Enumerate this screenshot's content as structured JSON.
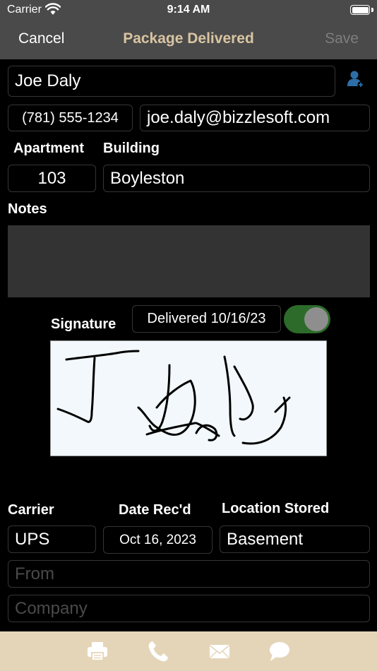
{
  "status": {
    "carrier": "Carrier",
    "time": "9:14 AM"
  },
  "nav": {
    "cancel": "Cancel",
    "title": "Package Delivered",
    "save": "Save"
  },
  "recipient": {
    "name": "Joe Daly",
    "phone": "(781) 555-1234",
    "email": "joe.daly@bizzlesoft.com"
  },
  "labels": {
    "apartment": "Apartment",
    "building": "Building",
    "notes": "Notes",
    "signature": "Signature",
    "carrier": "Carrier",
    "date_recd": "Date Rec'd",
    "location_stored": "Location Stored"
  },
  "unit": {
    "apartment": "103",
    "building": "Boyleston"
  },
  "notes": {
    "value": ""
  },
  "delivery": {
    "status_label": "Delivered 10/16/23",
    "delivered": true
  },
  "package": {
    "carrier": "UPS",
    "date_recd": "Oct 16, 2023",
    "location_stored": "Basement",
    "from_placeholder": "From",
    "company_placeholder": "Company"
  },
  "toolbar": {
    "icons": [
      "printer-icon",
      "phone-icon",
      "envelope-icon",
      "chat-bubble-icon"
    ]
  },
  "colors": {
    "bar_background": "#4a4a4a",
    "title_accent": "#d9c4a2",
    "toggle_on": "#2d6b2a",
    "contact_icon": "#2e6ea6",
    "toolbar_background": "#e5d5b8",
    "toolbar_icon": "#ffffff"
  }
}
